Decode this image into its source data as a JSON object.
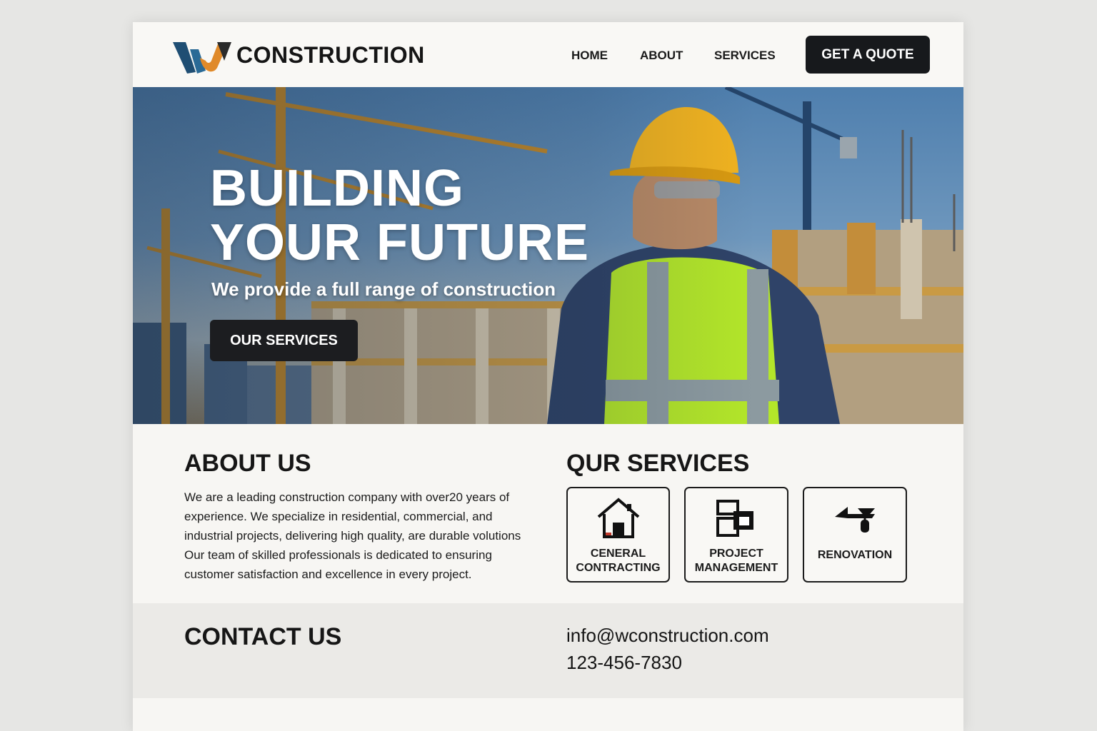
{
  "header": {
    "brand": "CONSTRUCTION",
    "nav": [
      "HOME",
      "ABOUT",
      "SERVICES"
    ],
    "cta": "GET A QUOTE"
  },
  "hero": {
    "title_line1": "BUILDING",
    "title_line2": "YOUR FUTURE",
    "subtitle": "We provide a full range of construction",
    "button": "OUR SERVICES"
  },
  "about": {
    "title": "ABOUT US",
    "text": "We are a leading construction company with over20 years of experience. We specialize in residential, commercial, and industrial projects, delivering high quality, are durable volutions Our team of skilled professionals is dedicated to ensuring customer satisfaction and excellence in every project."
  },
  "services": {
    "title": "QUR SERVICES",
    "cards": [
      {
        "line1": "CENERAL",
        "line2": "CONTRACTING",
        "icon": "house-icon"
      },
      {
        "line1": "PROJECT",
        "line2": "MANAGEMENT",
        "icon": "blocks-icon"
      },
      {
        "line1": "RENOVATION",
        "line2": "",
        "icon": "trowel-icon"
      }
    ]
  },
  "contact": {
    "title": "CONTACT US",
    "email": "info@wconstruction.com",
    "phone": "123-456-7830"
  },
  "colors": {
    "dark_button": "#17191c",
    "logo_blue": "#1f4e73",
    "logo_orange": "#e08a2a",
    "page_bg": "#f7f6f3",
    "contact_bg": "#ebeae7"
  }
}
